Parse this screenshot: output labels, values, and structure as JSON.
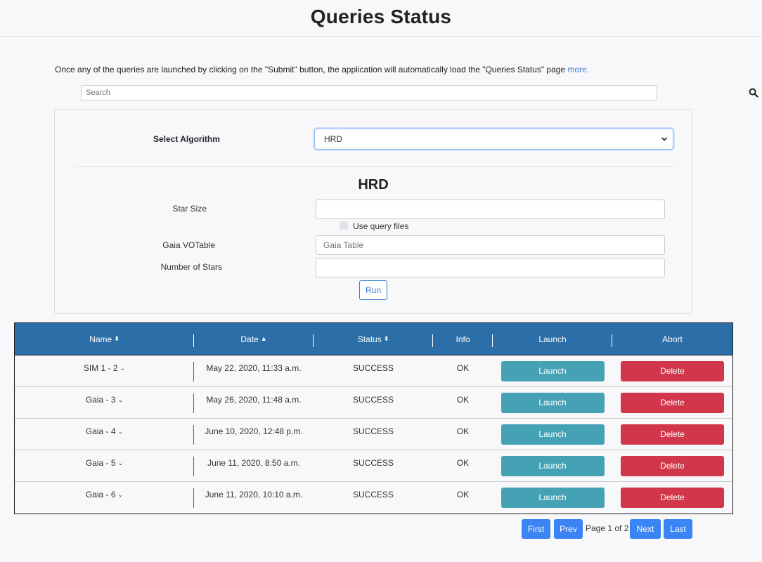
{
  "page": {
    "title": "Queries Status",
    "intro_text": "Once any of the queries are launched by clicking on the \"Submit\" button, the application will automatically load the \"Queries Status\" page ",
    "intro_link": "more."
  },
  "search": {
    "placeholder": "Search"
  },
  "algorithm": {
    "label": "Select Algorithm",
    "selected": "HRD",
    "section_title": "HRD"
  },
  "form": {
    "star_size_label": "Star Size",
    "star_size_value": "",
    "use_query_files_label": "Use query files",
    "gaia_votable_label": "Gaia VOTable",
    "gaia_votable_placeholder": "Gaia Table",
    "number_of_stars_label": "Number of Stars",
    "number_of_stars_value": "",
    "run_label": "Run"
  },
  "table": {
    "headers": [
      "Name",
      "Date",
      "Status",
      "Info",
      "Launch",
      "Abort"
    ],
    "sort_icons": [
      "sort-both-icon",
      "sort-up-icon",
      "sort-both-icon"
    ],
    "launch_label": "Launch",
    "delete_label": "Delete",
    "rows": [
      {
        "name": "SIM 1 - 2",
        "date": "May 22, 2020, 11:33 a.m.",
        "status": "SUCCESS",
        "info": "OK"
      },
      {
        "name": "Gaia - 3",
        "date": "May 26, 2020, 11:48 a.m.",
        "status": "SUCCESS",
        "info": "OK"
      },
      {
        "name": "Gaia - 4",
        "date": "June 10, 2020, 12:48 p.m.",
        "status": "SUCCESS",
        "info": "OK"
      },
      {
        "name": "Gaia - 5",
        "date": "June 11, 2020, 8:50 a.m.",
        "status": "SUCCESS",
        "info": "OK"
      },
      {
        "name": "Gaia - 6",
        "date": "June 11, 2020, 10:10 a.m.",
        "status": "SUCCESS",
        "info": "OK"
      }
    ]
  },
  "pagination": {
    "first": "First",
    "prev": "Prev",
    "page_text": "Page 1 of 2",
    "next": "Next",
    "last": "Last"
  },
  "colors": {
    "header_blue": "#2c6fa8",
    "launch_teal": "#45a2b5",
    "delete_red": "#d1364a",
    "pager_blue": "#3a84f5",
    "link_blue": "#3a7bd5"
  }
}
